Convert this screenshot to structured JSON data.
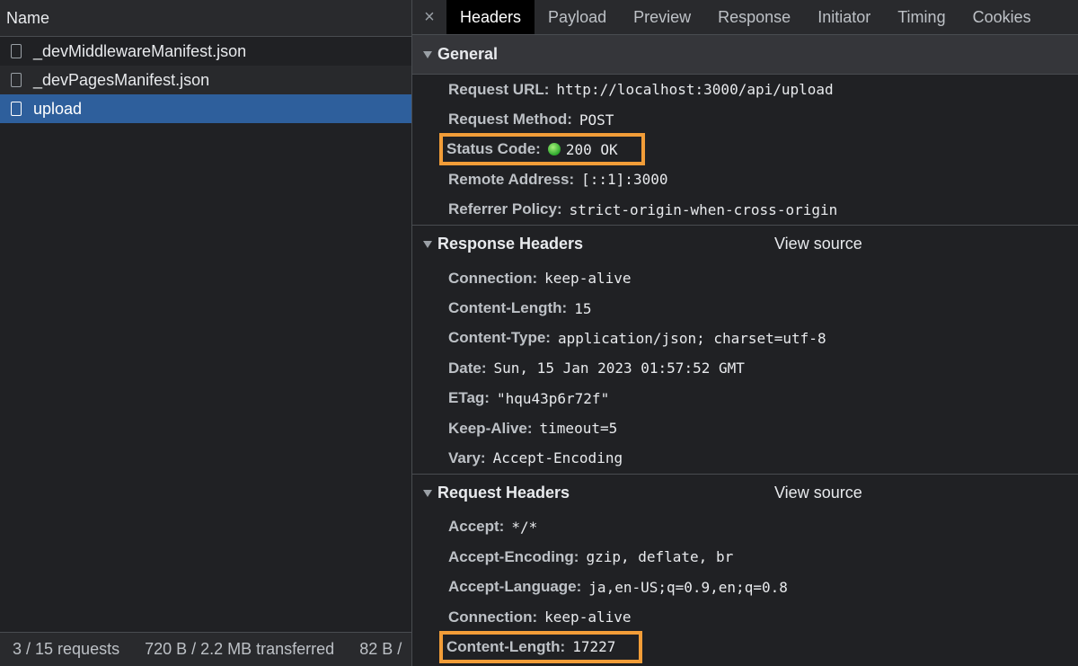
{
  "list": {
    "header": "Name",
    "requests": [
      {
        "name": "_devMiddlewareManifest.json"
      },
      {
        "name": "_devPagesManifest.json"
      },
      {
        "name": "upload"
      }
    ]
  },
  "footer": {
    "requests": "3 / 15 requests",
    "transferred": "720 B / 2.2 MB transferred",
    "resources": "82 B /"
  },
  "tabs": {
    "close": "×",
    "items": [
      "Headers",
      "Payload",
      "Preview",
      "Response",
      "Initiator",
      "Timing",
      "Cookies"
    ]
  },
  "general": {
    "title": "General",
    "rows": [
      {
        "k": "Request URL:",
        "v": "http://localhost:3000/api/upload"
      },
      {
        "k": "Request Method:",
        "v": "POST"
      },
      {
        "k": "Status Code:",
        "v": "200 OK"
      },
      {
        "k": "Remote Address:",
        "v": "[::1]:3000"
      },
      {
        "k": "Referrer Policy:",
        "v": "strict-origin-when-cross-origin"
      }
    ]
  },
  "response_headers": {
    "title": "Response Headers",
    "view_source": "View source",
    "rows": [
      {
        "k": "Connection:",
        "v": "keep-alive"
      },
      {
        "k": "Content-Length:",
        "v": "15"
      },
      {
        "k": "Content-Type:",
        "v": "application/json; charset=utf-8"
      },
      {
        "k": "Date:",
        "v": "Sun, 15 Jan 2023 01:57:52 GMT"
      },
      {
        "k": "ETag:",
        "v": "\"hqu43p6r72f\""
      },
      {
        "k": "Keep-Alive:",
        "v": "timeout=5"
      },
      {
        "k": "Vary:",
        "v": "Accept-Encoding"
      }
    ]
  },
  "request_headers": {
    "title": "Request Headers",
    "view_source": "View source",
    "rows": [
      {
        "k": "Accept:",
        "v": "*/*"
      },
      {
        "k": "Accept-Encoding:",
        "v": "gzip, deflate, br"
      },
      {
        "k": "Accept-Language:",
        "v": "ja,en-US;q=0.9,en;q=0.8"
      },
      {
        "k": "Connection:",
        "v": "keep-alive"
      },
      {
        "k": "Content-Length:",
        "v": "17227"
      }
    ]
  },
  "colors": {
    "selected_row": "#2e5f9c",
    "highlight_box": "#f29d38",
    "status_dot": "#2ca82c"
  }
}
